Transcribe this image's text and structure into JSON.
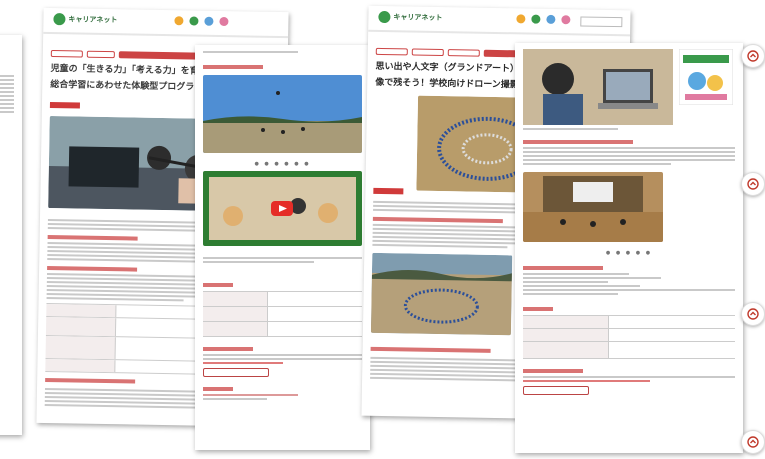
{
  "pages": [
    {
      "id": "page-1",
      "logo": "キャリアネット",
      "title_line1": "児童の「生きる力」「考える力」を育む新たな",
      "title_line2": "総合学習にあわせた体験型プログラミング学習"
    },
    {
      "id": "page-2"
    },
    {
      "id": "page-3",
      "logo": "キャリアネット",
      "title_line1": "思い出や人文字（グランドアート）を写",
      "title_line2": "像で残そう！学校向けドローン撮影サー"
    },
    {
      "id": "page-4"
    }
  ],
  "side_buttons": [
    {
      "icon": "chevron-up-icon"
    },
    {
      "icon": "chevron-up-icon"
    },
    {
      "icon": "chevron-up-icon"
    },
    {
      "icon": "chevron-up-icon"
    }
  ],
  "colors": {
    "accent": "#c0392b",
    "logo_green": "#3a9a4b",
    "sky": "#5a9fd8",
    "field": "#b89c6a",
    "youtube": "#e52d27"
  }
}
